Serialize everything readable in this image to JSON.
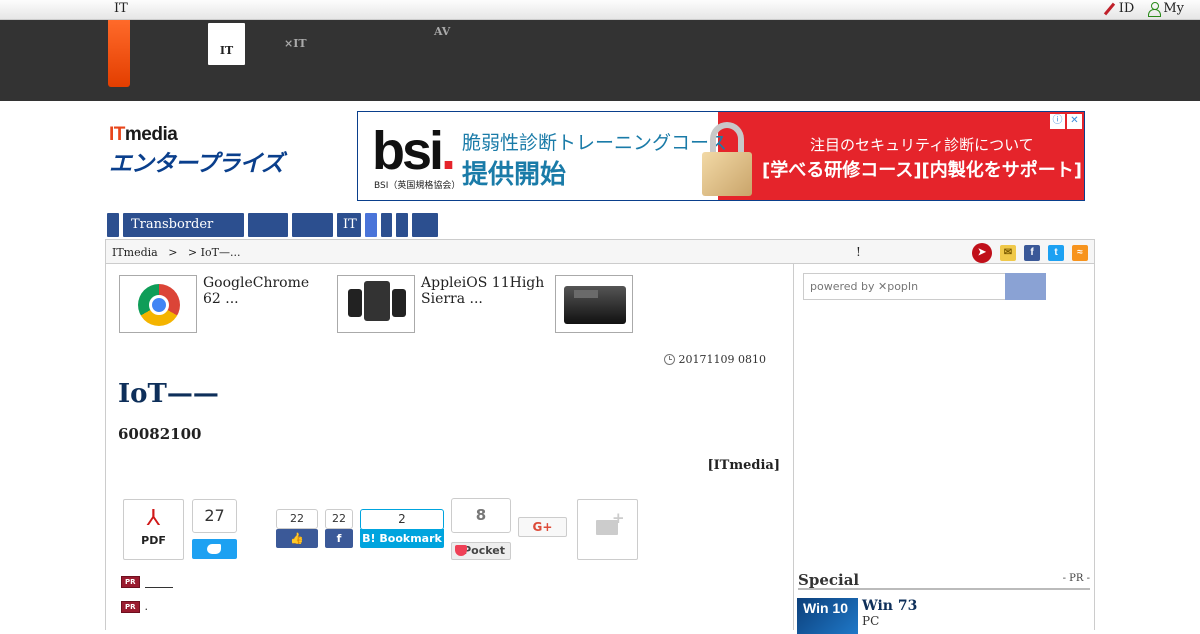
{
  "util": {
    "left_label": "IT",
    "id_label": "ID",
    "my_label": "My"
  },
  "site_tabs": [
    {
      "line1": "",
      "line2": "IT",
      "active": true
    },
    {
      "line1": "",
      "line2": "×IT",
      "active": false
    },
    {
      "line1": "AV",
      "line2": "",
      "active": false
    }
  ],
  "logo": {
    "it": "IT",
    "media": "media",
    "subtitle": "エンタープライズ"
  },
  "ad": {
    "brand": "bsi",
    "brand_sub": "BSI（英国規格協会）",
    "line1": "脆弱性診断トレーニングコース",
    "line2": "提供開始",
    "line3": "注目のセキュリティ診断について",
    "line4": "[学べる研修コース][内製化をサポート]",
    "info": "ⓘ",
    "close": "✕"
  },
  "nav": [
    "",
    "Transborder",
    "",
    "",
    "IT",
    "",
    "",
    "",
    ""
  ],
  "breadcrumb": {
    "text": "ITmedia   >   > IoT—...",
    "mark": "!"
  },
  "related": [
    {
      "title": "GoogleChrome\n62 ...",
      "thumb": "chrome"
    },
    {
      "title": "AppleiOS 11High\nSierra ...",
      "thumb": "phones"
    },
    {
      "title": "",
      "thumb": "printer"
    }
  ],
  "article": {
    "date": "20171109 0810",
    "title": "IoT——",
    "lead": "60082100",
    "byline": "[ITmedia]"
  },
  "share": {
    "pdf_label": "PDF",
    "tweet_count": "27",
    "like_count": "22",
    "fb_count": "22",
    "hatena_count": "2",
    "hatena_label": "Bookmark",
    "pocket_count": "8",
    "pocket_label": "Pocket",
    "gplus_label": "G+"
  },
  "pr_lines": [
    {
      "badge": "PR",
      "text": ""
    },
    {
      "badge": "PR",
      "text": "."
    }
  ],
  "sidebar": {
    "search_placeholder": "powered by ✕popIn",
    "special_heading": "Special",
    "special_pr": "- PR -",
    "item_thumb": "Win 10",
    "item_title": "Win 73",
    "item_sub": "PC"
  },
  "colors": {
    "brand_blue": "#2c4f8f",
    "accent_orange": "#e8461b",
    "ad_red": "#e5242b"
  }
}
